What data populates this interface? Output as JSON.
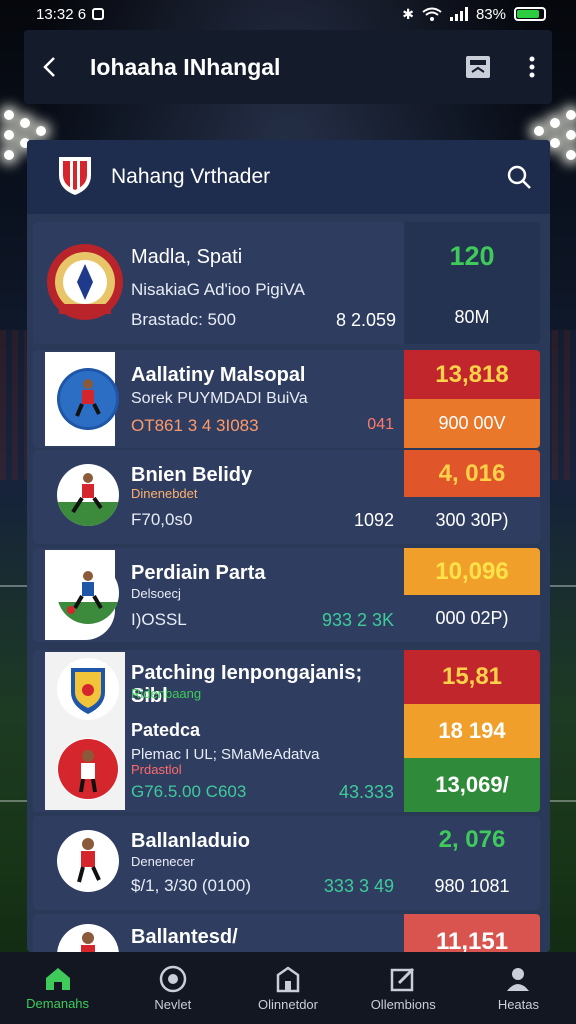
{
  "status_bar": {
    "time": "13:32 6",
    "battery": "83%"
  },
  "app_bar": {
    "title": "Iohaaha INhangal"
  },
  "panel": {
    "title": "Nahang Vrthader"
  },
  "top_card": {
    "name": "Madla, Spati",
    "subtitle": "NisakiaG Ad'ioo PigiVA",
    "meta": "Brastadc: 500",
    "meta_num": "8 2.059",
    "value": "120",
    "value_sub": "80M"
  },
  "players": [
    {
      "name": "Aallatiny Malsopal",
      "subtitle": "Sorek PUYMDADI BuiVa",
      "stats": "OT861 3 4 3I083",
      "delta": "041",
      "value": "13,818",
      "value_sub": "900  00V"
    },
    {
      "name": "Bnien Belidy",
      "tag": "Dinenebdet",
      "stats": "F70,0s0",
      "num": "1092",
      "value": "4, 016",
      "value_sub": "300  30P)"
    },
    {
      "name": "Perdiain Parta",
      "tag": "Delsoecj",
      "stats": "I)OSSL",
      "num": "933 2 3K",
      "value": "10,096",
      "value_sub": "000  02P)"
    },
    {
      "name": "Patching Ienpongajanis; Sibl",
      "tag": "Ridenbaang",
      "name2": "Patedca",
      "subtitle2": "Plemac I UL; SMaMeAdatva",
      "tag2": "Prdastlol",
      "stats": "G76.5.00  C603",
      "num": "43.333",
      "value": "15,81",
      "value2": "18 194",
      "value3": "13,069/"
    },
    {
      "name": "Ballanladuio",
      "tag": "Denenecer",
      "stats": "$/1, 3/30 (0100)",
      "num": "333 3 49",
      "value": "2, 076",
      "value_sub": "980  1081"
    },
    {
      "name": "Ballantesd/",
      "value": "11,151"
    }
  ],
  "bottom_nav": [
    {
      "label": "Demanahs",
      "icon": "home-icon"
    },
    {
      "label": "Nevlet",
      "icon": "ball-icon"
    },
    {
      "label": "Olinnetdor",
      "icon": "building-icon"
    },
    {
      "label": "Ollembions",
      "icon": "edit-icon"
    },
    {
      "label": "Heatas",
      "icon": "profile-icon"
    }
  ],
  "colors": {
    "accent_green": "#3ecb5a",
    "red": "#c0262b",
    "orange": "#e9782a",
    "amber": "#f0a02a",
    "green": "#2f8a3a",
    "panel": "#2a3958"
  }
}
